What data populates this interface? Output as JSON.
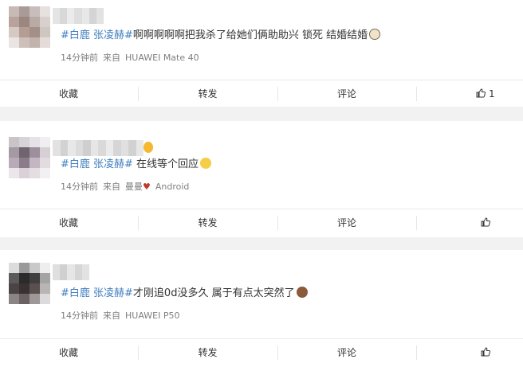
{
  "colors": {
    "hashtag": "#3f7fbf",
    "meta": "#808080",
    "background": "#f2f2f2"
  },
  "posts": [
    {
      "hashtag": "#白鹿 张凌赫#",
      "text": "啊啊啊啊啊把我杀了给她们俩助助兴 锁死 结婚结婚",
      "emoji": "face-icon",
      "time": "14分钟前",
      "source_prefix": "来自",
      "source": "HUAWEI Mate 40",
      "actions": {
        "favorite": "收藏",
        "repost": "转发",
        "comment": "评论",
        "like_count": "1"
      }
    },
    {
      "hashtag": "#白鹿 张凌赫#",
      "text": " 在线等个回应",
      "emoji": "crying-face-icon",
      "time": "14分钟前",
      "source_prefix": "来自",
      "source_name": "曼曼",
      "source": "Android",
      "actions": {
        "favorite": "收藏",
        "repost": "转发",
        "comment": "评论",
        "like_count": ""
      }
    },
    {
      "hashtag": "#白鹿 张凌赫#",
      "text": "才刚追0d没多久 属于有点太突然了",
      "emoji": "monkey-face-icon",
      "time": "14分钟前",
      "source_prefix": "来自",
      "source": "HUAWEI P50",
      "actions": {
        "favorite": "收藏",
        "repost": "转发",
        "comment": "评论",
        "like_count": ""
      }
    }
  ]
}
